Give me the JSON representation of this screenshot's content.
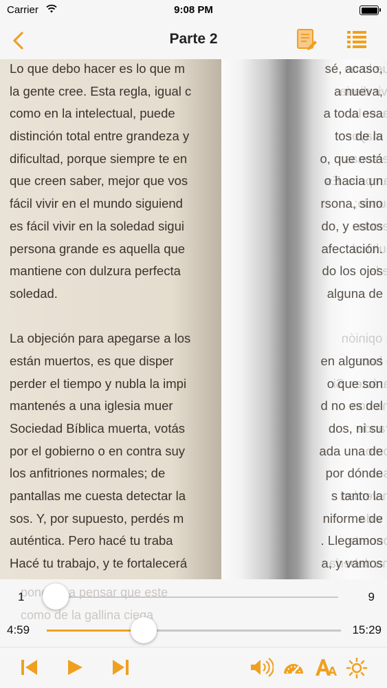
{
  "status": {
    "carrier": "Carrier",
    "time": "9:08 PM"
  },
  "nav": {
    "title": "Parte 2"
  },
  "page": {
    "lines": [
      "Lo que debo hacer es lo que m",
      "la gente cree. Esta regla, igual c",
      "como en la intelectual, puede",
      "distinción total entre grandeza y",
      "dificultad, porque siempre te en",
      "que creen saber, mejor que vos",
      "fácil vivir en el mundo siguiend",
      "es fácil vivir en la soledad sigui",
      "persona grande es aquella que",
      "mantiene con dulzura perfecta",
      "soledad.",
      "",
      "La objeción para apegarse a los",
      "están muertos, es que disper",
      "perder el tiempo y nubla la impi",
      "mantenés a una iglesia muer",
      "Sociedad Bíblica muerta, votás",
      "por el gobierno o en contra suy",
      "los anfitriones normales; de",
      "pantallas me cuesta detectar la",
      "sos. Y, por supuesto, perdés m",
      "auténtica. Pero hacé tu traba",
      "Hacé tu trabajo, y te fortalecerá"
    ],
    "behind_lines": [
      "sé, acaso,",
      "a  nueva,",
      "a  toda  esa",
      "tos  de  la",
      "o, que está",
      "o  hacia  un",
      "rsona,  sino",
      "do,  y  estos",
      "afectación.",
      "do  los  ojos",
      "alguna  de",
      "",
      "",
      "en  algunos",
      "o  que  son",
      "d  no  es  del",
      "dos,  ni  su",
      "ada  una  de",
      "por  dónde",
      "s   tanto  la",
      "niforme  de",
      ".  Llegamos",
      "a,  y  vamos"
    ],
    "mirror_lines": [
      "que lo on",
      "vivir diaria",
      "hacer la",
      "la mayor",
      "personas",
      "sampete. Es",
      "mundo;",
      "pero la",
      "multitud",
      "de la",
      "",
      "",
      "tu opinión",
      "te hace",
      "carácter. Si",
      "una con",
      "grande",
      "como",
      "esas",
      "en verdad",
      "tu vida",
      "concerte.",
      "una debería"
    ],
    "ghost_lines": [
      "ponerse a pensar que este",
      "como de la gallina ciega"
    ]
  },
  "controls": {
    "page_start": "1",
    "page_end": "9",
    "page_progress": 0.03,
    "time_elapsed": "4:59",
    "time_total": "15:29",
    "audio_progress": 0.33
  },
  "colors": {
    "accent": "#f0a020"
  },
  "icons": {
    "back": "chevron-left-icon",
    "notes": "notes-icon",
    "toc": "list-icon",
    "prev": "skip-back-icon",
    "play": "play-icon",
    "next": "skip-forward-icon",
    "volume": "speaker-icon",
    "speed": "speedometer-icon",
    "font": "font-size-icon",
    "brightness": "brightness-icon"
  }
}
